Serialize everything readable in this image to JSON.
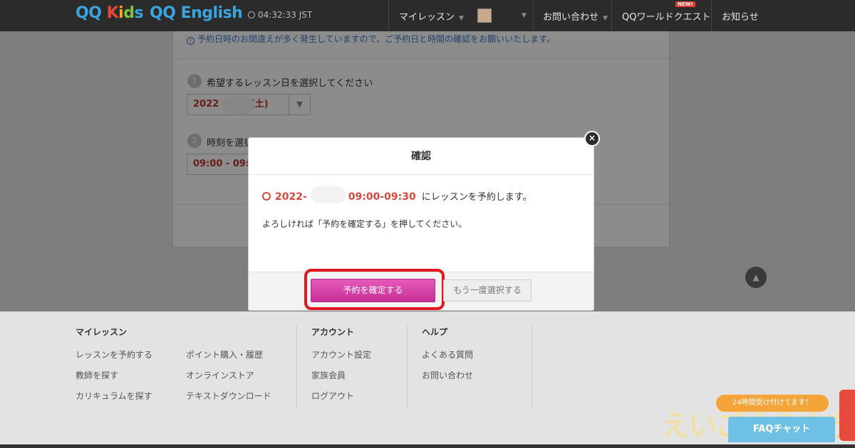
{
  "header": {
    "logo_kids": "QQ Kids",
    "logo_english": "QQ English",
    "clock_time": "04:32:33 JST",
    "nav": {
      "my_lessons": "マイレッスン",
      "contact": "お問い合わせ",
      "world_quest": "QQワールドクエスト",
      "news": "お知らせ",
      "new_badge": "NEW!"
    }
  },
  "booking": {
    "notice": "予約日時のお間違えが多く発生していますので、ご予約日と時間の確認をお願いいたします。",
    "step1": {
      "num": "1",
      "label": "希望するレッスン日を選択してください",
      "value_year": "2022",
      "value_day": "(土)"
    },
    "step2": {
      "num": "2",
      "label": "時刻を選択",
      "value": "09:00 - 09:"
    }
  },
  "modal": {
    "title": "確認",
    "close": "×",
    "date_prefix": "2022-",
    "time_range": "09:00-09:30",
    "confirm_text": "にレッスンを予約します。",
    "prompt": "よろしければ「予約を確定する」を押してください。",
    "confirm_button": "予約を確定する",
    "reselect_button": "もう一度選択する"
  },
  "footer": {
    "columns": [
      {
        "heading": "マイレッスン",
        "links": [
          "レッスンを予約する",
          "教師を探す",
          "カリキュラムを探す"
        ]
      },
      {
        "heading": "",
        "links": [
          "ポイント購入・履歴",
          "オンラインストア",
          "テキストダウンロード"
        ]
      },
      {
        "heading": "アカウント",
        "links": [
          "アカウント設定",
          "家族会員",
          "ログアウト"
        ]
      },
      {
        "heading": "ヘルプ",
        "links": [
          "よくある質問",
          "お問い合わせ"
        ]
      }
    ]
  },
  "chat": {
    "tag": "24時間受け付けてます！",
    "button": "FAQチャット"
  },
  "watermark": "えいごすきすき",
  "colors": {
    "accent_pink": "#d23aa3",
    "highlight_red": "#e3161e",
    "date_red": "#d04a3d",
    "link_blue": "#3b78c3"
  }
}
